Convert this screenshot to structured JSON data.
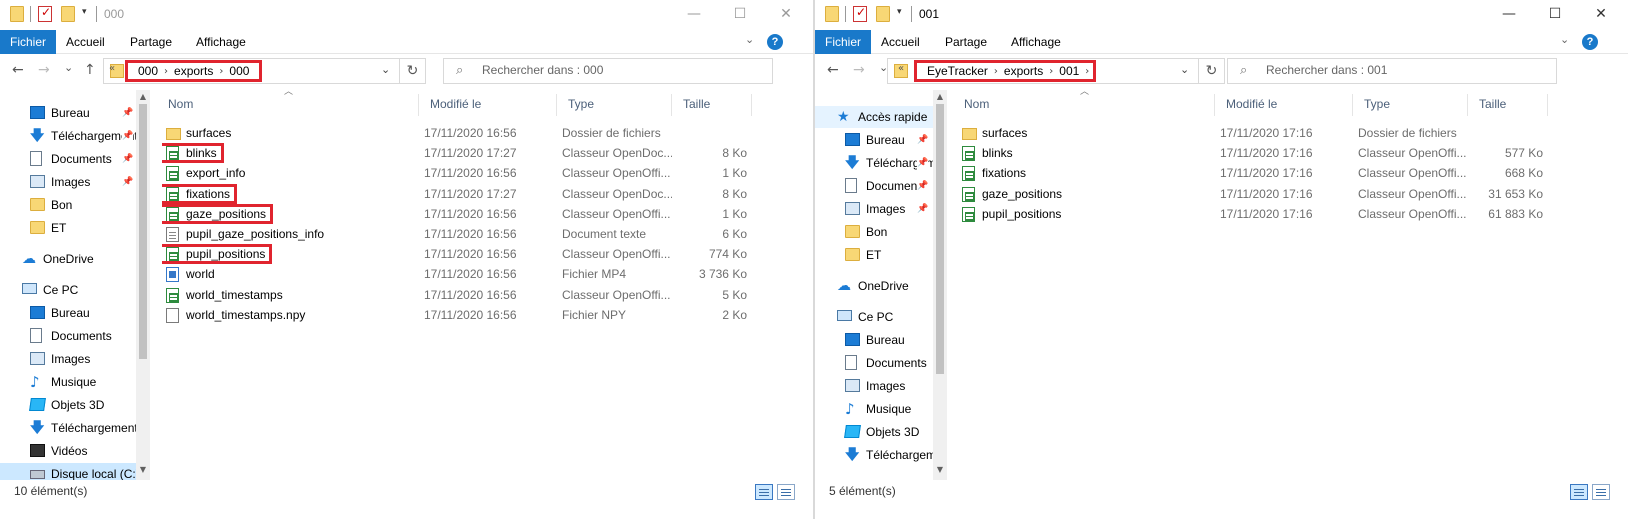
{
  "colors": {
    "accent": "#1979ca",
    "highlight": "#e0242e",
    "selected": "#cce8ff"
  },
  "windows": [
    {
      "title": "000",
      "active": false,
      "ribbon": {
        "file": "Fichier",
        "home": "Accueil",
        "share": "Partage",
        "view": "Affichage"
      },
      "breadcrumb": [
        "000",
        "exports",
        "000"
      ],
      "search_placeholder": "Rechercher dans : 000",
      "sidebar": [
        {
          "label": "Bureau",
          "icon": "desktop-icon",
          "pinned": true
        },
        {
          "label": "Téléchargements",
          "icon": "download-icon",
          "pinned": true
        },
        {
          "label": "Documents",
          "icon": "documents-icon",
          "pinned": true
        },
        {
          "label": "Images",
          "icon": "images-icon",
          "pinned": true
        },
        {
          "label": "Bon",
          "icon": "folder-icon",
          "pinned": false
        },
        {
          "label": "ET",
          "icon": "folder-icon",
          "pinned": false
        },
        {
          "label": "OneDrive",
          "icon": "cloud-icon",
          "pinned": false
        },
        {
          "label": "Ce PC",
          "icon": "pc-icon",
          "pinned": false
        },
        {
          "label": "Bureau",
          "icon": "desktop-icon",
          "pinned": false
        },
        {
          "label": "Documents",
          "icon": "documents-icon",
          "pinned": false
        },
        {
          "label": "Images",
          "icon": "images-icon",
          "pinned": false
        },
        {
          "label": "Musique",
          "icon": "music-icon",
          "pinned": false
        },
        {
          "label": "Objets 3D",
          "icon": "3d-objects-icon",
          "pinned": false
        },
        {
          "label": "Téléchargements",
          "icon": "download-icon",
          "pinned": false
        },
        {
          "label": "Vidéos",
          "icon": "videos-icon",
          "pinned": false
        },
        {
          "label": "Disque local (C:)",
          "icon": "disk-icon",
          "pinned": false,
          "selected": true
        }
      ],
      "columns": {
        "name": "Nom",
        "date": "Modifié le",
        "type": "Type",
        "size": "Taille"
      },
      "files": [
        {
          "name": "surfaces",
          "date": "17/11/2020 16:56",
          "type": "Dossier de fichiers",
          "size": "",
          "icon": "folder",
          "highlight": false
        },
        {
          "name": "blinks",
          "date": "17/11/2020 17:27",
          "type": "Classeur OpenDoc...",
          "size": "8 Ko",
          "icon": "sheet",
          "highlight": true
        },
        {
          "name": "export_info",
          "date": "17/11/2020 16:56",
          "type": "Classeur OpenOffi...",
          "size": "1 Ko",
          "icon": "sheet",
          "highlight": false
        },
        {
          "name": "fixations",
          "date": "17/11/2020 17:27",
          "type": "Classeur OpenDoc...",
          "size": "8 Ko",
          "icon": "sheet",
          "highlight": true
        },
        {
          "name": "gaze_positions",
          "date": "17/11/2020 16:56",
          "type": "Classeur OpenOffi...",
          "size": "1 Ko",
          "icon": "sheet",
          "highlight": true
        },
        {
          "name": "pupil_gaze_positions_info",
          "date": "17/11/2020 16:56",
          "type": "Document texte",
          "size": "6 Ko",
          "icon": "text",
          "highlight": false
        },
        {
          "name": "pupil_positions",
          "date": "17/11/2020 16:56",
          "type": "Classeur OpenOffi...",
          "size": "774 Ko",
          "icon": "sheet",
          "highlight": true
        },
        {
          "name": "world",
          "date": "17/11/2020 16:56",
          "type": "Fichier MP4",
          "size": "3 736 Ko",
          "icon": "video",
          "highlight": false
        },
        {
          "name": "world_timestamps",
          "date": "17/11/2020 16:56",
          "type": "Classeur OpenOffi...",
          "size": "5 Ko",
          "icon": "sheet",
          "highlight": false
        },
        {
          "name": "world_timestamps.npy",
          "date": "17/11/2020 16:56",
          "type": "Fichier NPY",
          "size": "2 Ko",
          "icon": "blank",
          "highlight": false
        }
      ],
      "status": "10 élément(s)"
    },
    {
      "title": "001",
      "active": true,
      "ribbon": {
        "file": "Fichier",
        "home": "Accueil",
        "share": "Partage",
        "view": "Affichage"
      },
      "breadcrumb": [
        "EyeTracker",
        "exports",
        "001"
      ],
      "search_placeholder": "Rechercher dans : 001",
      "sidebar": [
        {
          "label": "Accès rapide",
          "icon": "star-icon",
          "pinned": false,
          "quickaccess": true
        },
        {
          "label": "Bureau",
          "icon": "desktop-icon",
          "pinned": true
        },
        {
          "label": "Téléchargements",
          "icon": "download-icon",
          "pinned": true
        },
        {
          "label": "Documents",
          "icon": "documents-icon",
          "pinned": true
        },
        {
          "label": "Images",
          "icon": "images-icon",
          "pinned": true
        },
        {
          "label": "Bon",
          "icon": "folder-icon",
          "pinned": false
        },
        {
          "label": "ET",
          "icon": "folder-icon",
          "pinned": false
        },
        {
          "label": "OneDrive",
          "icon": "cloud-icon",
          "pinned": false
        },
        {
          "label": "Ce PC",
          "icon": "pc-icon",
          "pinned": false
        },
        {
          "label": "Bureau",
          "icon": "desktop-icon",
          "pinned": false
        },
        {
          "label": "Documents",
          "icon": "documents-icon",
          "pinned": false
        },
        {
          "label": "Images",
          "icon": "images-icon",
          "pinned": false
        },
        {
          "label": "Musique",
          "icon": "music-icon",
          "pinned": false
        },
        {
          "label": "Objets 3D",
          "icon": "3d-objects-icon",
          "pinned": false
        },
        {
          "label": "Téléchargements",
          "icon": "download-icon",
          "pinned": false
        }
      ],
      "columns": {
        "name": "Nom",
        "date": "Modifié le",
        "type": "Type",
        "size": "Taille"
      },
      "files": [
        {
          "name": "surfaces",
          "date": "17/11/2020 17:16",
          "type": "Dossier de fichiers",
          "size": "",
          "icon": "folder",
          "highlight": false
        },
        {
          "name": "blinks",
          "date": "17/11/2020 17:16",
          "type": "Classeur OpenOffi...",
          "size": "577 Ko",
          "icon": "sheet",
          "highlight": false
        },
        {
          "name": "fixations",
          "date": "17/11/2020 17:16",
          "type": "Classeur OpenOffi...",
          "size": "668 Ko",
          "icon": "sheet",
          "highlight": false
        },
        {
          "name": "gaze_positions",
          "date": "17/11/2020 17:16",
          "type": "Classeur OpenOffi...",
          "size": "31 653 Ko",
          "icon": "sheet",
          "highlight": false
        },
        {
          "name": "pupil_positions",
          "date": "17/11/2020 17:16",
          "type": "Classeur OpenOffi...",
          "size": "61 883 Ko",
          "icon": "sheet",
          "highlight": false
        }
      ],
      "status": "5 élément(s)"
    }
  ]
}
